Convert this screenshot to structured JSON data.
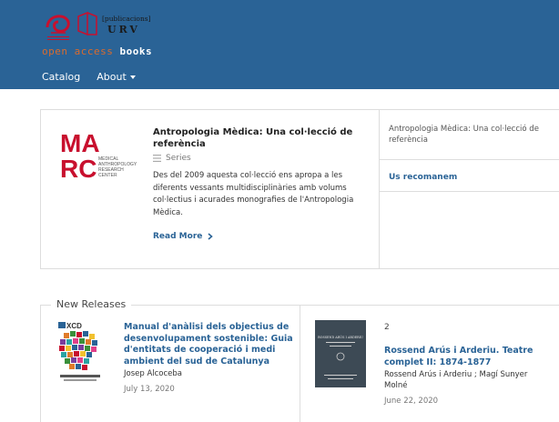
{
  "header": {
    "logo_orange": "open access",
    "logo_white": "books",
    "pub_line1": "[publicacions]",
    "pub_line2": "URV"
  },
  "nav": {
    "catalog": "Catalog",
    "about": "About"
  },
  "series": {
    "logo_letters_top": "MA",
    "logo_letters_bottom": "RC",
    "logo_caption": [
      "MEDICAL",
      "ANTHROPOLOGY",
      "RESEARCH",
      "CENTER"
    ],
    "title": "Antropologia Mèdica: Una col·lecció de referència",
    "tag": "Series",
    "description": "Des del 2009 aquesta col·lecció ens apropa a les diferents vessants multidisciplinàries amb volums col·lectius i acurades monografies de l'Antropologia Mèdica.",
    "read_more": "Read More"
  },
  "side": {
    "title": "Antropologia Mèdica: Una col·lecció de referència",
    "link": "Us recomanem"
  },
  "new_releases": {
    "label": "New Releases",
    "books": [
      {
        "cover_text": "XCD",
        "title": "Manual d'anàlisi dels objectius de desenvolupament sostenible: Guia d'entitats de cooperació i medi ambient del sud de Catalunya",
        "author": "Josep Alcoceba",
        "date": "July 13, 2020"
      },
      {
        "number": "2",
        "cover_text": "ROSSEND ARÚS I ARDERIU",
        "title": "Rossend Arús i Arderiu. Teatre complet II: 1874-1877",
        "author": "Rossend Arús i Arderiu ; Magí Sunyer Molné",
        "date": "June 22, 2020"
      }
    ]
  },
  "colors": {
    "header_bg": "#2a6396",
    "link": "#2a6396",
    "logo_orange": "#d96b2e",
    "marc_red": "#c8102e"
  }
}
